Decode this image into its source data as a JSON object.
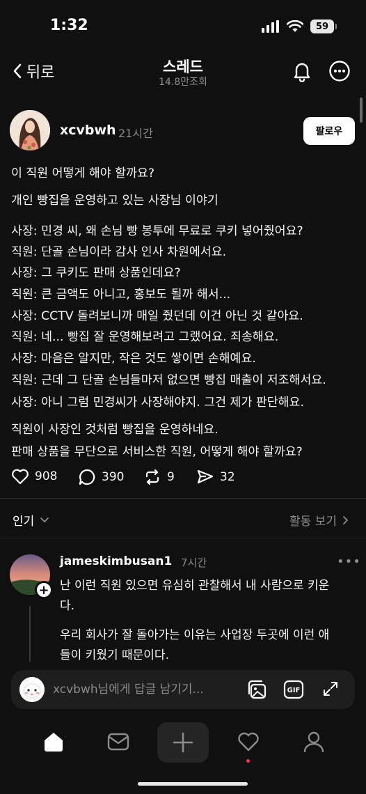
{
  "status_bar": {
    "time": "1:32",
    "battery": "59"
  },
  "header": {
    "back_label": "뒤로",
    "title": "스레드",
    "views": "14.8만조회"
  },
  "post": {
    "username": "xcvbwh",
    "time": "21시간",
    "follow_label": "팔로우",
    "lines": [
      "이 직원 어떻게 해야 할까요?",
      "개인 빵집을 운영하고 있는 사장님 이야기",
      "사장: 민경 씨, 왜 손님 빵 봉투에 무료로 쿠키 넣어줬어요?",
      "직원: 단골 손님이라 감사 인사 차원에서요.",
      "사장: 그 쿠키도 판매 상품인데요?",
      "직원: 큰 금액도 아니고, 홍보도 될까 해서...",
      "사장: CCTV 돌려보니까 매일 줬던데 이건 아닌 것 같아요.",
      "직원: 네... 빵집 잘 운영해보려고 그랬어요. 죄송해요.",
      "사장: 마음은 알지만, 작은 것도 쌓이면 손해예요.",
      "직원: 근데 그 단골 손님들마저 없으면 빵집 매출이 저조해서요.",
      "사장: 아니 그럼 민경씨가 사장해야지. 그건 제가 판단해요.",
      "직원이 사장인 것처럼 빵집을 운영하네요.",
      "판매 상품을 무단으로 서비스한 직원, 어떻게 해야 할까요?"
    ],
    "likes": "908",
    "comments": "390",
    "reposts": "9",
    "shares": "32"
  },
  "sort": {
    "popular_label": "인기",
    "activity_label": "활동 보기"
  },
  "reply": {
    "username": "jameskimbusan1",
    "time": "7시간",
    "lines": [
      "난 이런 직원 있으면 유심히 관찰해서 내 사람으로 키운",
      "다.",
      "우리 회사가 잘 돌아가는 이유는 사업장 두곳에 이런 애",
      "들이 키웠기 때문이다."
    ]
  },
  "composer": {
    "placeholder": "xcvbwh님에게 답글 남기기..."
  },
  "icons": [
    "wifi-icon",
    "signal-icon",
    "bell-icon",
    "more-icon",
    "heart-icon",
    "comment-icon",
    "repost-icon",
    "share-icon",
    "gallery-icon",
    "gif-icon",
    "expand-icon",
    "home-icon",
    "inbox-icon",
    "plus-icon",
    "activity-icon",
    "profile-icon"
  ],
  "colors": {
    "background": "#101010",
    "text": "#f3f5f7",
    "muted": "#8c8c8c",
    "notification_dot": "#ff3040"
  }
}
